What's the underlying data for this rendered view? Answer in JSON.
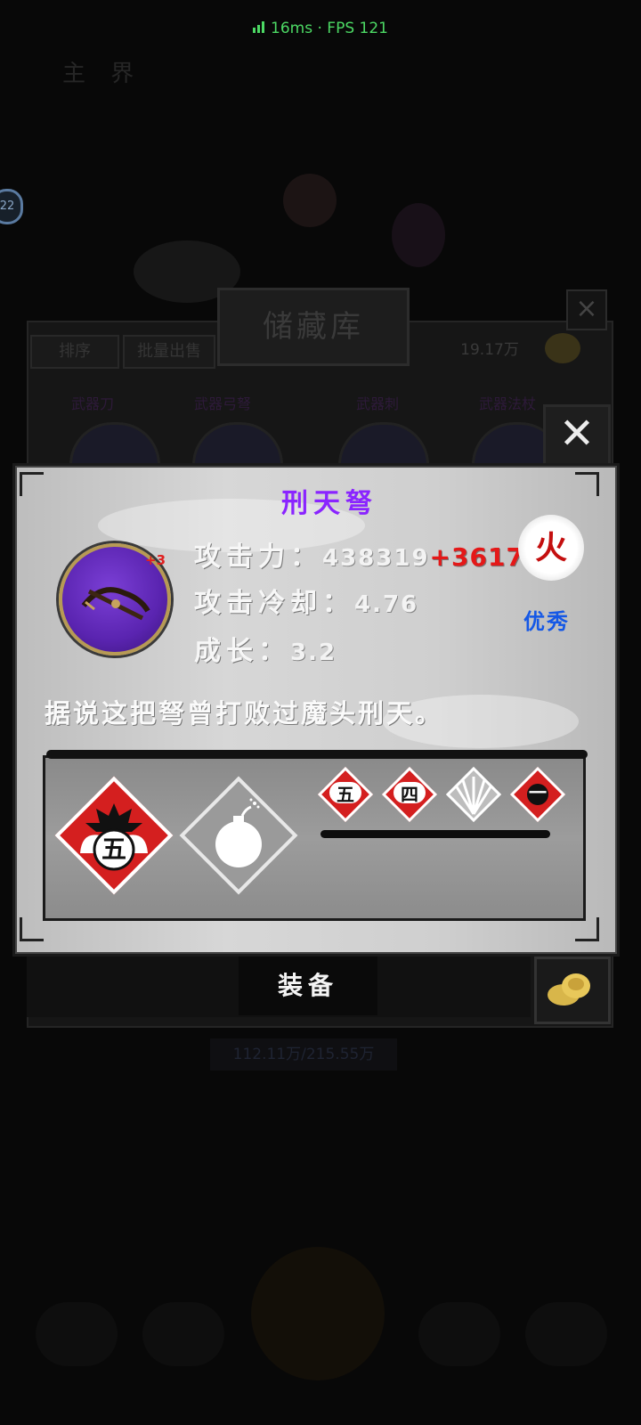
{
  "perf": {
    "text": "16ms · FPS 121"
  },
  "background": {
    "top_label": "主 界",
    "badge": "22"
  },
  "storage": {
    "title": "储藏库",
    "sort_tab": "排序",
    "batch_sell_tab": "批量出售",
    "money": "19.17万",
    "categories": [
      "武器刀",
      "武器弓弩",
      "武器刺",
      "武器法杖"
    ],
    "capacity": "112.11万/215.55万",
    "close_icon": "close-icon"
  },
  "item": {
    "name": "刑天弩",
    "name_color": "#8a24ff",
    "enhance_level": "+3",
    "attack_label": "攻击力",
    "attack_value": "438319",
    "attack_bonus": "+361747",
    "cooldown_label": "攻击冷却",
    "cooldown_value": "4.76",
    "growth_label": "成长",
    "growth_value": "3.2",
    "separator": "：",
    "element": "火",
    "quality": "优秀",
    "description": "据说这把弩曾打败过魔头刑天。",
    "skills": [
      {
        "name": "burst-five-icon",
        "glyph": "五"
      },
      {
        "name": "bomb-icon",
        "glyph": ""
      }
    ],
    "sub_skills": [
      "五",
      "四",
      "fan-icon",
      "一"
    ]
  },
  "actions": {
    "equip_label": "装备",
    "sell_icon": "coin-pile-icon"
  },
  "colors": {
    "bonus": "#e41818",
    "quality": "#1558e6",
    "element": "#c40f0f",
    "perf": "#4cd964"
  }
}
